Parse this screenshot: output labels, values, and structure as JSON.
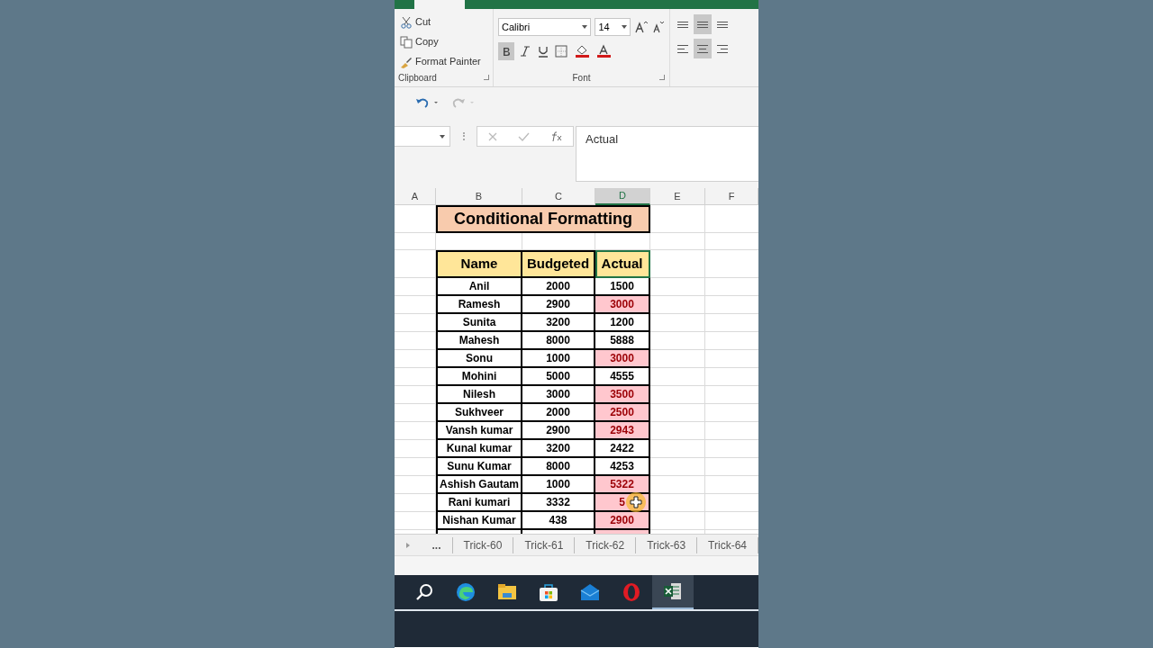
{
  "ribbon": {
    "clipboard": {
      "items": [
        {
          "kind": "cut",
          "label": "Cut"
        },
        {
          "kind": "copy",
          "label": "Copy"
        },
        {
          "kind": "painter",
          "label": "Format Painter"
        }
      ],
      "group_label": "Clipboard"
    },
    "font": {
      "name": "Calibri",
      "size": "14",
      "bold": true,
      "group_label": "Font"
    },
    "alignment": {
      "vertical": [
        {
          "selected": false
        },
        {
          "selected": true
        },
        {
          "selected": false
        }
      ],
      "horizontal": [
        {
          "selected": false
        },
        {
          "selected": true
        },
        {
          "selected": false
        }
      ]
    }
  },
  "formula_bar": {
    "content": "Actual"
  },
  "columns": [
    {
      "label": "A",
      "selected": false
    },
    {
      "label": "B",
      "selected": false
    },
    {
      "label": "C",
      "selected": false
    },
    {
      "label": "D",
      "selected": true
    },
    {
      "label": "E",
      "selected": false
    },
    {
      "label": "F",
      "selected": false
    }
  ],
  "sheet": {
    "title": "Conditional Formatting",
    "headers": [
      "Name",
      "Budgeted",
      "Actual"
    ],
    "rows": [
      {
        "name": "Anil",
        "budgeted": "2000",
        "actual": "1500",
        "highlighted": false
      },
      {
        "name": "Ramesh",
        "budgeted": "2900",
        "actual": "3000",
        "highlighted": true
      },
      {
        "name": "Sunita",
        "budgeted": "3200",
        "actual": "1200",
        "highlighted": false
      },
      {
        "name": "Mahesh",
        "budgeted": "8000",
        "actual": "5888",
        "highlighted": false
      },
      {
        "name": "Sonu",
        "budgeted": "1000",
        "actual": "3000",
        "highlighted": true
      },
      {
        "name": "Mohini",
        "budgeted": "5000",
        "actual": "4555",
        "highlighted": false
      },
      {
        "name": "Nilesh",
        "budgeted": "3000",
        "actual": "3500",
        "highlighted": true
      },
      {
        "name": "Sukhveer",
        "budgeted": "2000",
        "actual": "2500",
        "highlighted": true
      },
      {
        "name": "Vansh kumar",
        "budgeted": "2900",
        "actual": "2943",
        "highlighted": true
      },
      {
        "name": "Kunal kumar",
        "budgeted": "3200",
        "actual": "2422",
        "highlighted": false
      },
      {
        "name": "Sunu Kumar",
        "budgeted": "8000",
        "actual": "4253",
        "highlighted": false
      },
      {
        "name": "Ashish Gautam",
        "budgeted": "1000",
        "actual": "5322",
        "highlighted": true
      },
      {
        "name": "Rani kumari",
        "budgeted": "3332",
        "actual": "5",
        "highlighted": true
      },
      {
        "name": "Nishan Kumar",
        "budgeted": "438",
        "actual": "2900",
        "highlighted": true
      }
    ]
  },
  "sheet_tabs": [
    {
      "label": "...",
      "selected": false
    },
    {
      "label": "Trick-60",
      "selected": false
    },
    {
      "label": "Trick-61",
      "selected": false
    },
    {
      "label": "Trick-62",
      "selected": false
    },
    {
      "label": "Trick-63",
      "selected": false
    },
    {
      "label": "Trick-64",
      "selected": false
    }
  ],
  "taskbar": [
    {
      "kind": "search",
      "selected": false
    },
    {
      "kind": "browser",
      "selected": false
    },
    {
      "kind": "folder",
      "selected": false
    },
    {
      "kind": "store",
      "selected": false
    },
    {
      "kind": "mail",
      "selected": false
    },
    {
      "kind": "opera",
      "selected": false
    },
    {
      "kind": "excel",
      "selected": true
    }
  ]
}
